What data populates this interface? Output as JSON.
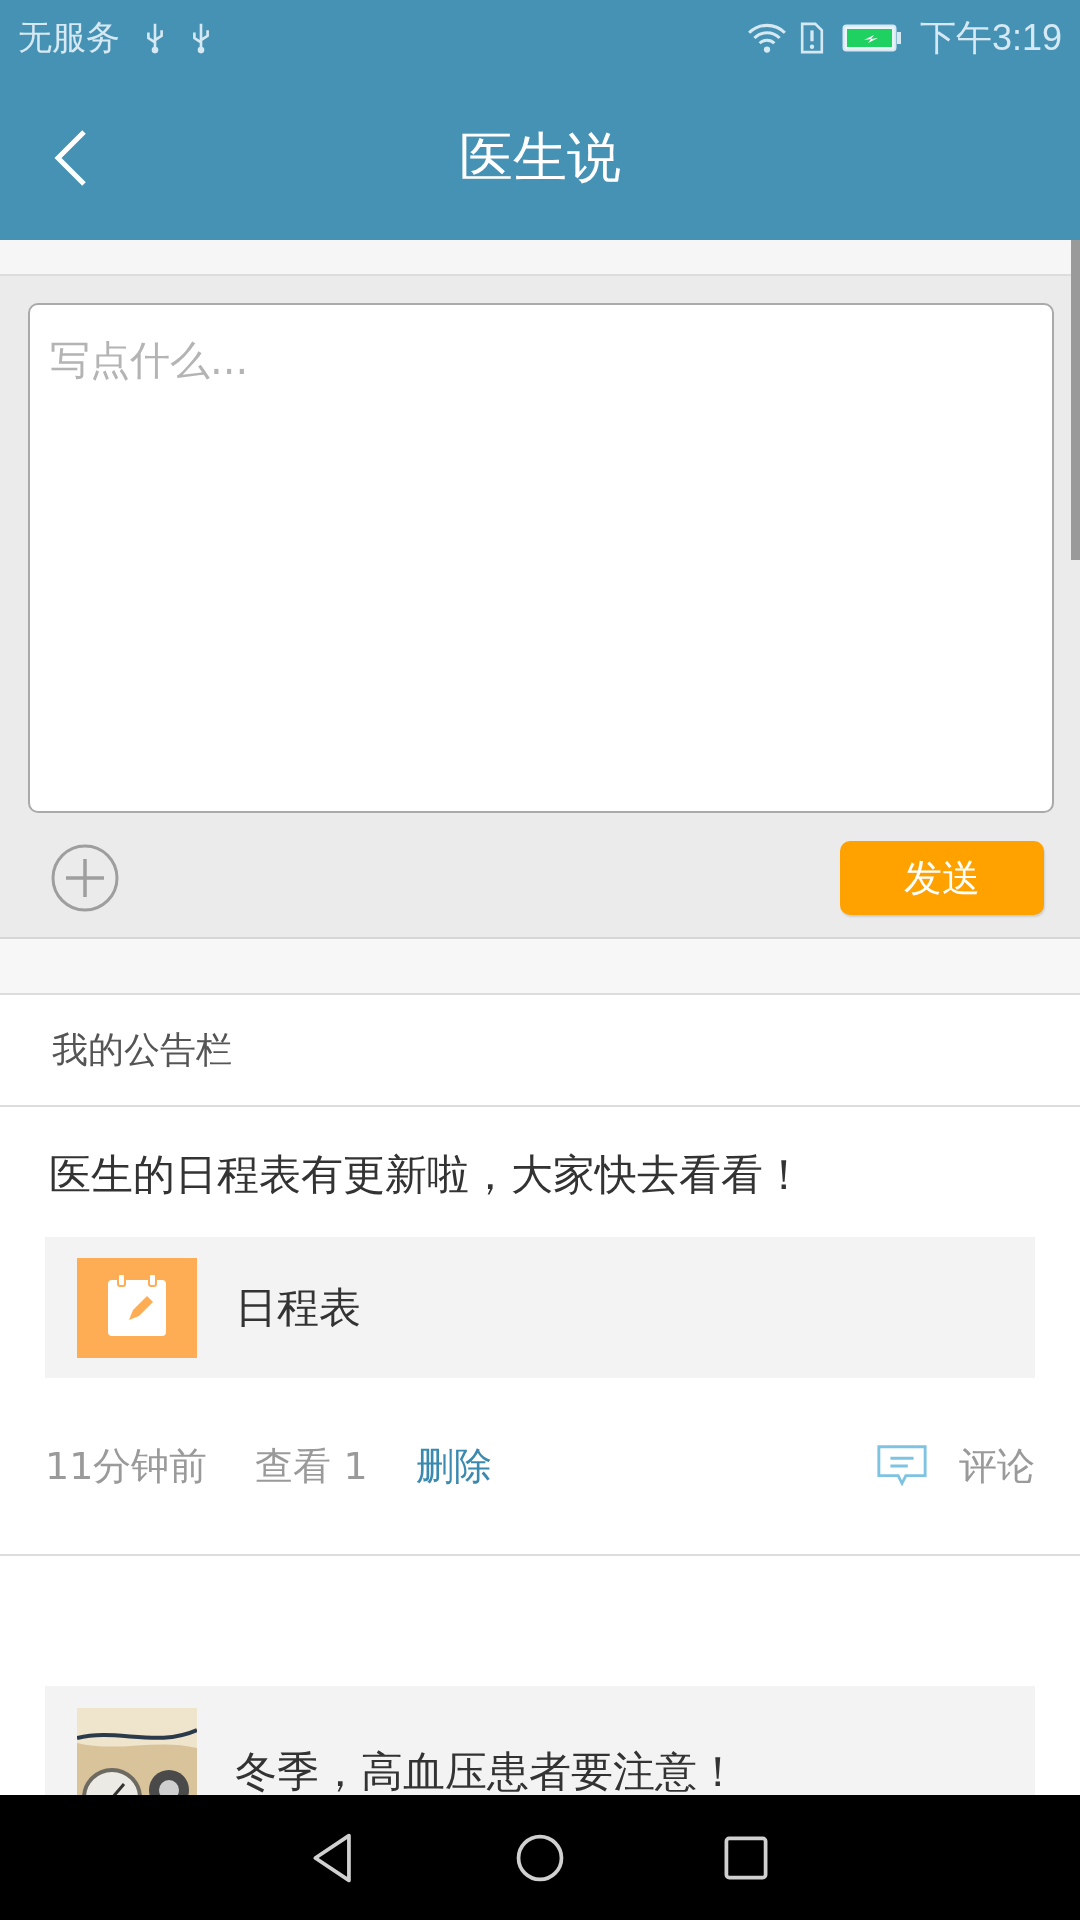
{
  "status_bar": {
    "carrier": "无服务",
    "time": "下午3:19"
  },
  "app_bar": {
    "title": "医生说"
  },
  "composer": {
    "placeholder": "写点什么...",
    "send_button": "发送"
  },
  "board": {
    "title": "我的公告栏"
  },
  "posts": [
    {
      "text": "医生的日程表有更新啦，大家快去看看！",
      "attachment": {
        "kind": "schedule",
        "title": "日程表"
      },
      "time": "11分钟前",
      "views": "查看 1",
      "delete": "删除",
      "comment": "评论"
    },
    {
      "attachment": {
        "kind": "picture",
        "title": "冬季，高血压患者要注意！"
      }
    }
  ]
}
